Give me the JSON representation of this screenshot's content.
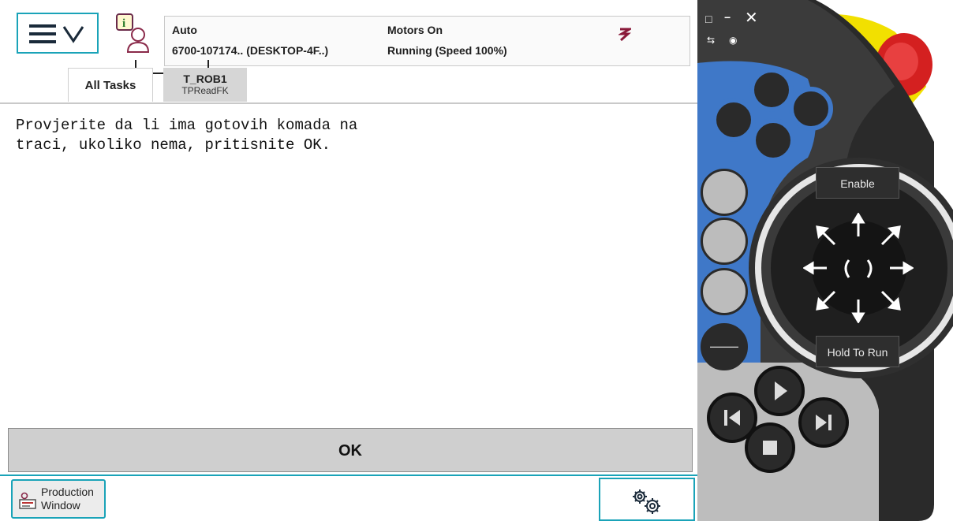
{
  "statusbar": {
    "mode": "Auto",
    "controller": "6700-107174.. (DESKTOP-4F..)",
    "motors": "Motors On",
    "program_state": "Running (Speed 100%)"
  },
  "tabs": {
    "all_tasks": "All Tasks",
    "task_name": "T_ROB1",
    "task_module": "TPReadFK"
  },
  "message": {
    "line1": "Provjerite da li ima gotovih komada na",
    "line2": "traci, ukoliko nema, pritisnite OK."
  },
  "ok_button": "OK",
  "production_window": {
    "line1": "Production",
    "line2": "Window"
  },
  "pendant": {
    "enable_label": "Enable",
    "hold_to_run_label": "Hold To Run"
  },
  "colors": {
    "accent": "#1aa3b8",
    "pendant_blue": "#3f78c8",
    "emergency_red": "#d42020",
    "guard_yellow": "#f2e000"
  },
  "icons": [
    "menu-icon",
    "chevron-down-icon",
    "event-log-icon",
    "robot-icon",
    "production-window-icon",
    "settings-gears-icon",
    "play-icon",
    "stop-icon",
    "step-back-icon",
    "step-forward-icon",
    "emergency-stop-icon"
  ]
}
